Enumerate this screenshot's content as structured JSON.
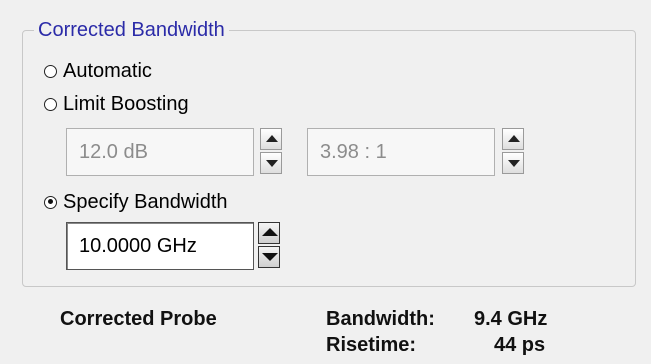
{
  "group": {
    "title": "Corrected Bandwidth"
  },
  "options": {
    "automatic": {
      "label": "Automatic",
      "selected": false
    },
    "limit_boosting": {
      "label": "Limit Boosting",
      "selected": false
    },
    "specify_bandwidth": {
      "label": "Specify Bandwidth",
      "selected": true
    }
  },
  "limit_boosting_fields": {
    "db_value": "12.0 dB",
    "ratio_value": "3.98 : 1",
    "enabled": false
  },
  "bandwidth_field": {
    "value": "10.0000 GHz",
    "enabled": true
  },
  "corrected_probe": {
    "label": "Corrected Probe",
    "bandwidth_label": "Bandwidth:",
    "bandwidth_value": "9.4 GHz",
    "risetime_label": "Risetime:",
    "risetime_value": "44 ps"
  }
}
